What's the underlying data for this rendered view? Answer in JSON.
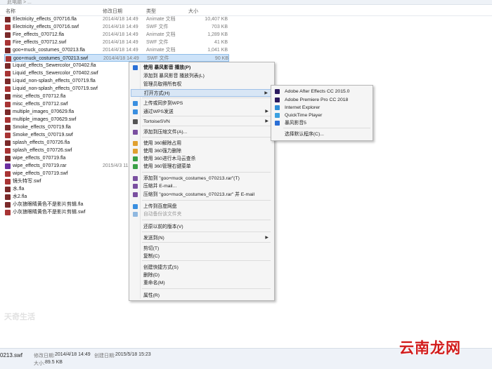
{
  "topbar": {
    "text": "此电脑 > ..."
  },
  "header": {
    "col_name": "名称",
    "col_date": "修改日期",
    "col_type": "类型",
    "col_size": "大小"
  },
  "files": [
    {
      "name": "Electricity_effects_070716.fla",
      "date": "2014/4/18 14:49",
      "type": "Animate 文档",
      "size": "10,407 KB",
      "icon": "fla"
    },
    {
      "name": "Electricity_effects_070716.swf",
      "date": "2014/4/18 14:49",
      "type": "SWF 文件",
      "size": "703 KB",
      "icon": "swf"
    },
    {
      "name": "Fire_effects_070712.fla",
      "date": "2014/4/18 14:49",
      "type": "Animate 文档",
      "size": "1,289 KB",
      "icon": "fla"
    },
    {
      "name": "Fire_effects_070712.swf",
      "date": "2014/4/18 14:49",
      "type": "SWF 文件",
      "size": "41 KB",
      "icon": "swf"
    },
    {
      "name": "goo+muck_costumes_070213.fla",
      "date": "2014/4/18 14:49",
      "type": "Animate 文档",
      "size": "1,041 KB",
      "icon": "fla"
    },
    {
      "name": "goo+muck_costumes_070213.swf",
      "date": "2014/4/18 14:49",
      "type": "SWF 文件",
      "size": "90 KB",
      "icon": "swf"
    },
    {
      "name": "Liquid_effects_Sewercolor_070402.fla",
      "date": "",
      "type": "",
      "size": "",
      "icon": "fla"
    },
    {
      "name": "Liquid_effects_Sewercolor_070402.swf",
      "date": "",
      "type": "",
      "size": "",
      "icon": "swf"
    },
    {
      "name": "Liquid_non-splash_effects_070719.fla",
      "date": "",
      "type": "",
      "size": "",
      "icon": "fla"
    },
    {
      "name": "Liquid_non-splash_effects_070719.swf",
      "date": "",
      "type": "",
      "size": "",
      "icon": "swf"
    },
    {
      "name": "misc_effects_070712.fla",
      "date": "",
      "type": "",
      "size": "",
      "icon": "fla"
    },
    {
      "name": "misc_effects_070712.swf",
      "date": "",
      "type": "",
      "size": "",
      "icon": "swf"
    },
    {
      "name": "multiple_images_070629.fla",
      "date": "",
      "type": "",
      "size": "",
      "icon": "fla"
    },
    {
      "name": "multiple_images_070629.swf",
      "date": "",
      "type": "",
      "size": "",
      "icon": "swf"
    },
    {
      "name": "Smoke_effects_070719.fla",
      "date": "",
      "type": "",
      "size": "",
      "icon": "fla"
    },
    {
      "name": "Smoke_effects_070719.swf",
      "date": "",
      "type": "",
      "size": "",
      "icon": "swf"
    },
    {
      "name": "splash_effects_070726.fla",
      "date": "",
      "type": "",
      "size": "",
      "icon": "fla"
    },
    {
      "name": "splash_effects_070726.swf",
      "date": "",
      "type": "",
      "size": "",
      "icon": "swf"
    },
    {
      "name": "wipe_effects_070719.fla",
      "date": "",
      "type": "",
      "size": "",
      "icon": "fla"
    },
    {
      "name": "wipe_effects_070719.rar",
      "date": "2015/4/3 11",
      "type": "",
      "size": "",
      "icon": "rar"
    },
    {
      "name": "wipe_effects_070719.swf",
      "date": "",
      "type": "",
      "size": "",
      "icon": "swf"
    },
    {
      "name": "镜头特写.swf",
      "date": "",
      "type": "",
      "size": "",
      "icon": "swf"
    },
    {
      "name": "水.fla",
      "date": "",
      "type": "",
      "size": "",
      "icon": "fla"
    },
    {
      "name": "水2.fla",
      "date": "",
      "type": "",
      "size": "",
      "icon": "fla"
    },
    {
      "name": "小灰狼眼睛黄色不是影片剪辑.fla",
      "date": "",
      "type": "",
      "size": "",
      "icon": "fla"
    },
    {
      "name": "小灰狼眼睛黄色不是影片剪辑.swf",
      "date": "",
      "type": "",
      "size": "",
      "icon": "swf"
    }
  ],
  "context_menu": {
    "items": [
      {
        "label": "使用 暴风影音 播放(P)",
        "bold": true,
        "icon": "play-icon",
        "color": "#2a6fd6"
      },
      {
        "label": "添加到 暴风影音 播放列表(L)",
        "icon": "",
        "color": ""
      },
      {
        "label": "管理员取得所有权",
        "icon": "",
        "color": ""
      },
      {
        "label": "打开方式(H)",
        "arrow": true,
        "highlight": true,
        "icon": "",
        "color": ""
      },
      {
        "label": "上传或同步到WPS",
        "icon": "cloud-icon",
        "color": "#3a8fe0"
      },
      {
        "label": "通过WPS发送",
        "arrow": true,
        "icon": "send-icon",
        "color": "#3a8fe0"
      },
      {
        "label": "TortoiseSVN",
        "arrow": true,
        "icon": "svn-icon",
        "color": "#555555"
      },
      {
        "label": "添加到压缩文件(A)...",
        "icon": "archive-icon",
        "color": "#7a4fa0"
      },
      {
        "label": "使用 360解除占用",
        "icon": "shield-icon",
        "color": "#e0a030"
      },
      {
        "label": "使用 360强力删除",
        "icon": "shield-icon",
        "color": "#e0a030"
      },
      {
        "label": "使用 360进行木马云查杀",
        "icon": "shield-icon",
        "color": "#3aa046"
      },
      {
        "label": "使用 360管理右键菜单",
        "icon": "shield-icon",
        "color": "#3aa046"
      },
      {
        "label": "添加到 \"goo+muck_costumes_070213.rar\"(T)",
        "icon": "archive-icon",
        "color": "#7a4fa0"
      },
      {
        "label": "压缩并 E-mail...",
        "icon": "archive-icon",
        "color": "#7a4fa0"
      },
      {
        "label": "压缩到 \"goo+muck_costumes_070213.rar\" 并 E-mail",
        "icon": "archive-icon",
        "color": "#7a4fa0"
      },
      {
        "label": "上传到百度网盘",
        "icon": "cloud-icon",
        "color": "#3a8fe0"
      },
      {
        "label": "自动备份该文件夹",
        "disabled": true,
        "icon": "cloud-icon",
        "color": "#8fb8e0"
      },
      {
        "label": "还原以前的版本(V)",
        "icon": "",
        "color": ""
      },
      {
        "label": "发送到(N)",
        "arrow": true,
        "icon": "",
        "color": ""
      },
      {
        "label": "剪切(T)",
        "icon": "",
        "color": ""
      },
      {
        "label": "复制(C)",
        "icon": "",
        "color": ""
      },
      {
        "label": "创建快捷方式(S)",
        "icon": "",
        "color": ""
      },
      {
        "label": "删除(D)",
        "icon": "",
        "color": ""
      },
      {
        "label": "重命名(M)",
        "icon": "",
        "color": ""
      },
      {
        "label": "属性(R)",
        "icon": "",
        "color": ""
      }
    ]
  },
  "submenu": {
    "items": [
      {
        "label": "Adobe After Effects CC 2015.0",
        "icon": "after-effects-icon",
        "color": "#2a1a5e"
      },
      {
        "label": "Adobe Premiere Pro CC 2018",
        "icon": "premiere-icon",
        "color": "#2a1a5e"
      },
      {
        "label": "Internet Explorer",
        "icon": "ie-icon",
        "color": "#2f8fd8"
      },
      {
        "label": "QuickTime Player",
        "icon": "quicktime-icon",
        "color": "#3aa0e0"
      },
      {
        "label": "暴风影音5",
        "icon": "baofeng-icon",
        "color": "#2a6fd6"
      },
      {
        "label": "选择默认程序(C)...",
        "icon": "",
        "color": ""
      }
    ]
  },
  "details": {
    "filename": "0213.swf",
    "modified_label": "修改日期:",
    "modified_value": "2014/4/18 14:49",
    "created_label": "创建日期:",
    "created_value": "2015/5/18 15:23",
    "size_label": "大小:",
    "size_value": "89.5 KB"
  },
  "watermark": {
    "left": "天奇生活",
    "right": "云南龙网"
  }
}
